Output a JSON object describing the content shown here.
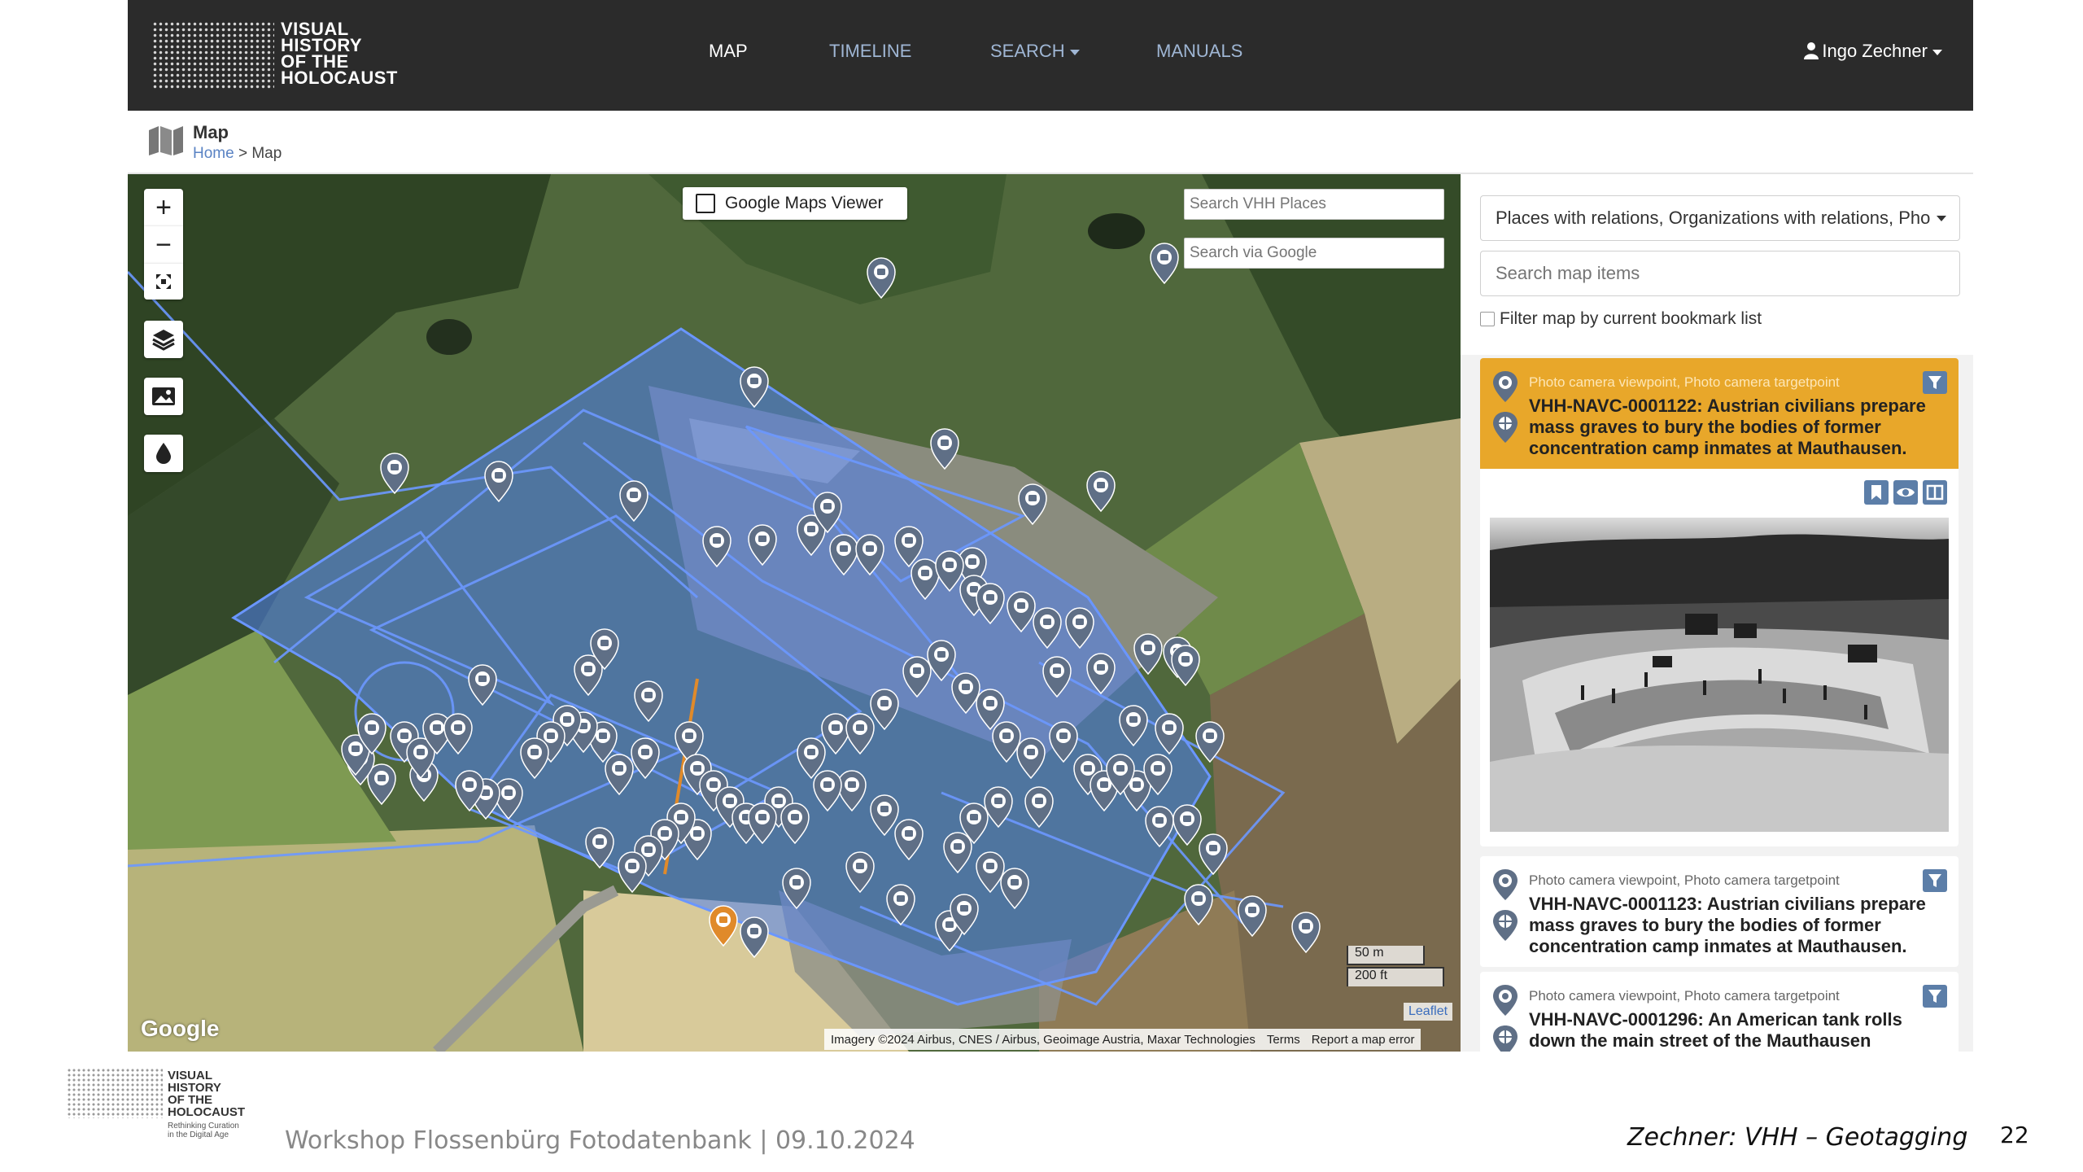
{
  "nav": {
    "logo_lines": [
      "VISUAL",
      "HISTORY",
      "OF THE",
      "HOLOCAUST"
    ],
    "links": [
      {
        "label": "MAP",
        "active": true
      },
      {
        "label": "TIMELINE"
      },
      {
        "label": "SEARCH"
      },
      {
        "label": "MANUALS"
      }
    ],
    "user": "Ingo Zechner"
  },
  "breadcrumb": {
    "title": "Map",
    "home": "Home",
    "separator": ">",
    "current": "Map"
  },
  "map": {
    "viewer_toggle_label": "Google Maps Viewer",
    "search_places_placeholder": "Search VHH Places",
    "search_google_placeholder": "Search via Google",
    "scale_m": "50 m",
    "scale_ft": "200 ft",
    "leaflet": "Leaflet",
    "google_logo": "Google",
    "attribution": "Imagery ©2024 Airbus, CNES / Airbus, Geoimage Austria, Maxar Technologies",
    "terms": "Terms",
    "report": "Report a map error",
    "controls": [
      "zoom-in",
      "zoom-out",
      "fullscreen",
      "layers",
      "image",
      "drop"
    ],
    "accent_blue": "#5b8cf0",
    "marker_gray": "#5f6f86",
    "selected_marker": "#e08a2a"
  },
  "sidebar": {
    "filter_select": "Places with relations, Organizations with relations, Pho",
    "search_placeholder": "Search map items",
    "bookmark_filter_label": "Filter map by current bookmark list",
    "highlight_color": "#e8a72a",
    "cards": [
      {
        "type": "Photo camera viewpoint, Photo camera targetpoint",
        "title": "VHH-NAVC-0001122: Austrian civilians prepare mass graves to bury the bodies of former concentration camp inmates at Mauthausen.",
        "selected": true
      },
      {
        "type": "Photo camera viewpoint, Photo camera targetpoint",
        "title": "VHH-NAVC-0001123: Austrian civilians prepare mass graves to bury the bodies of former concentration camp inmates at Mauthausen."
      },
      {
        "type": "Photo camera viewpoint, Photo camera targetpoint",
        "title": "VHH-NAVC-0001296: An American tank rolls down the main street of the Mauthausen concentration camp."
      }
    ]
  },
  "slide_footer": {
    "logo_lines": [
      "VISUAL",
      "HISTORY",
      "OF THE",
      "HOLOCAUST"
    ],
    "logo_tagline": [
      "Rethinking Curation",
      "in the Digital Age"
    ],
    "event": "Workshop Flossenbürg Fotodatenbank | 09.10.2024",
    "author_title": "Zechner: VHH – Geotagging",
    "page_number": "22"
  }
}
